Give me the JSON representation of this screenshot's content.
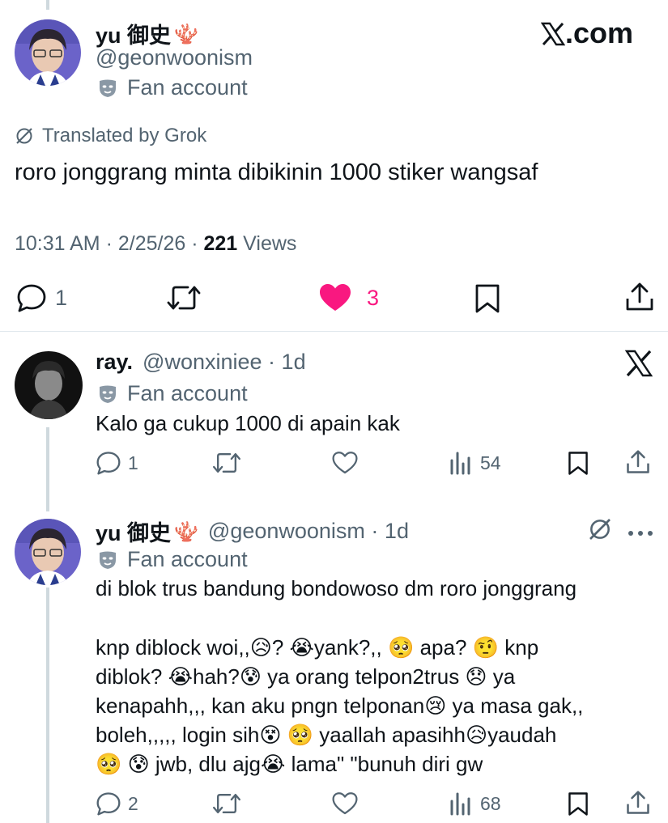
{
  "main_post": {
    "display_name": "yu 御史",
    "name_emoji": "🪸",
    "handle": "@geonwoonism",
    "badge": "Fan account",
    "site_logo": "𝕏.com",
    "translated_label": "Translated by Grok",
    "text": "roro jonggrang minta dibikinin 1000 stiker wangsaf",
    "time": "10:31 AM",
    "date": "2/25/26",
    "views_count": "221",
    "views_label": "Views",
    "replies": "1",
    "likes": "3",
    "like_color": "#f91880"
  },
  "replies": [
    {
      "display_name": "ray.",
      "handle": "@wonxiniee",
      "age": "1d",
      "badge": "Fan account",
      "text": "Kalo ga cukup 1000 di apain kak",
      "replies": "1",
      "views": "54",
      "corner_icon": "x-logo-icon"
    },
    {
      "display_name": "yu 御史",
      "name_emoji": "🪸",
      "handle": "@geonwoonism",
      "age": "1d",
      "badge": "Fan account",
      "text_line1": "di blok trus bandung bondowoso dm roro jonggrang",
      "text_lines": [
        "knp diblock woi,,😥? 😭yank?,, 🥺 apa? 🤨 knp",
        "diblok? 😭hah?😰 ya orang telpon2trus 😞 ya",
        "kenapahh,,, kan aku pngn telponan😢 ya masa gak,,",
        "boleh,,,,, login sih😵 🥺 yaallah apasihh😥yaudah",
        "🥺 😰 jwb, dlu ajg😭 lama\" \"bunuh diri gw"
      ],
      "replies": "2",
      "views": "68",
      "corner_icons": [
        "grok-icon",
        "more-icon"
      ]
    }
  ]
}
